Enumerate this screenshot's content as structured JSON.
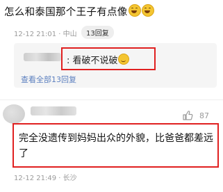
{
  "comment1": {
    "text": "怎么和泰国那个王子有点像",
    "emojis": [
      "grin-emoji",
      "grin-emoji"
    ],
    "time": "12-12 21:01",
    "location": "中山",
    "reply_count": "13回复"
  },
  "reply_preview": {
    "text": ": 看破不说破",
    "emoji": "smirk-emoji",
    "view_all": "查看全部13回复"
  },
  "comment2": {
    "likes": "87",
    "text": "完全没遗传到妈妈出众的外貌，比爸爸都差远了",
    "time": "12-12 21:49",
    "location": "长沙"
  },
  "colors": {
    "highlight": "#e02020",
    "link": "#5b7fbf",
    "meta": "#9a9a9a"
  }
}
